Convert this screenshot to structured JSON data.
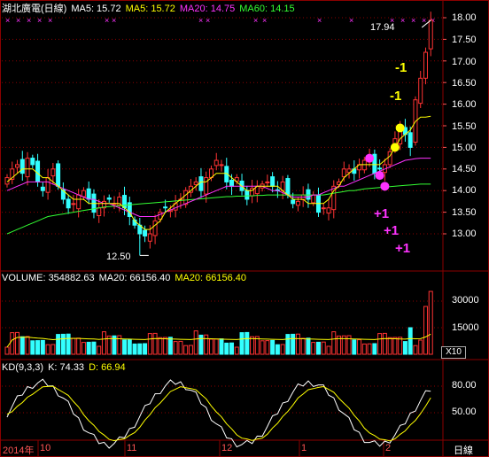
{
  "header": {
    "title": "湖北廣電(日線)",
    "ma5_a": "MA5: 15.72",
    "ma5_b": "MA5: 15.72",
    "ma20": "MA20: 14.75",
    "ma60": "MA60: 14.15"
  },
  "price_axis": [
    "18.00",
    "17.50",
    "17.00",
    "16.50",
    "16.00",
    "15.50",
    "15.00",
    "14.50",
    "14.00",
    "13.50",
    "13.00"
  ],
  "labels": {
    "high": "17.94",
    "low": "12.50"
  },
  "annotations": {
    "minus1": "-1",
    "minus2": "-1",
    "plus1": "+1",
    "plus2": "+1",
    "plus3": "+1"
  },
  "volume": {
    "header": "VOLUME: 354882.63",
    "ma20_a": "MA20: 66156.40",
    "ma20_b": "MA20: 66156.40",
    "axis": [
      "30000",
      "15000"
    ],
    "unit": "X10"
  },
  "kd": {
    "header": "KD(9,3,3)",
    "k": "K: 74.33",
    "d": "D: 66.94",
    "axis": [
      "80.00",
      "50.00"
    ]
  },
  "time_axis": {
    "months": [
      "2014年",
      "10",
      "11",
      "12",
      "1",
      "2"
    ],
    "period": "日線"
  },
  "colors": {
    "up": "#ff3333",
    "down": "#33ffff",
    "ma5": "#ffff00",
    "ma20": "#ff33ff",
    "ma60": "#33ff33",
    "grid": "#8b0000"
  },
  "chart_data": {
    "type": "candlestick",
    "close": [
      14.3,
      14.5,
      14.6,
      14.4,
      14.75,
      14.6,
      14.2,
      14.0,
      14.3,
      14.5,
      14.1,
      13.8,
      13.6,
      13.7,
      13.9,
      14.0,
      13.8,
      13.5,
      13.6,
      13.75,
      13.8,
      13.7,
      13.85,
      13.6,
      13.4,
      13.2,
      13.0,
      12.95,
      13.0,
      13.3,
      13.5,
      13.6,
      13.55,
      13.7,
      13.8,
      14.0,
      14.1,
      14.2,
      14.0,
      14.3,
      14.5,
      14.7,
      14.6,
      14.2,
      14.1,
      14.3,
      14.0,
      13.8,
      14.05,
      14.1,
      14.15,
      14.2,
      14.1,
      14.0,
      14.2,
      13.9,
      13.7,
      13.75,
      13.9,
      13.8,
      13.9,
      13.5,
      13.6,
      13.6,
      14.1,
      14.2,
      14.5,
      14.5,
      14.4,
      14.6,
      14.7,
      14.8,
      14.4,
      14.5,
      14.6,
      14.9,
      15.2,
      15.5,
      15.3,
      15.0,
      16.1,
      16.6,
      17.2,
      17.94
    ],
    "ma5": [
      14.2,
      14.3,
      14.4,
      14.5,
      14.5,
      14.5,
      14.4,
      14.3,
      14.3,
      14.2,
      14.1,
      14.0,
      13.9,
      13.8,
      13.8,
      13.8,
      13.7,
      13.7,
      13.7,
      13.7,
      13.7,
      13.7,
      13.7,
      13.6,
      13.5,
      13.3,
      13.2,
      13.1,
      13.1,
      13.2,
      13.3,
      13.5,
      13.6,
      13.7,
      13.8,
      13.9,
      14.0,
      14.1,
      14.2,
      14.2,
      14.3,
      14.4,
      14.4,
      14.4,
      14.3,
      14.2,
      14.1,
      14.0,
      14.0,
      14.1,
      14.1,
      14.1,
      14.1,
      14.1,
      14.0,
      13.9,
      13.8,
      13.8,
      13.8,
      13.7,
      13.7,
      13.7,
      13.7,
      13.8,
      14.0,
      14.1,
      14.3,
      14.4,
      14.5,
      14.6,
      14.6,
      14.6,
      14.6,
      14.6,
      14.7,
      14.8,
      15.0,
      15.2,
      15.3,
      15.4,
      15.6,
      15.7,
      15.7,
      15.72
    ],
    "ma20": [
      14.0,
      14.05,
      14.1,
      14.15,
      14.2,
      14.2,
      14.2,
      14.2,
      14.2,
      14.15,
      14.1,
      14.05,
      14.0,
      13.95,
      13.9,
      13.85,
      13.8,
      13.8,
      13.75,
      13.7,
      13.7,
      13.65,
      13.6,
      13.55,
      13.5,
      13.45,
      13.4,
      13.4,
      13.4,
      13.4,
      13.45,
      13.5,
      13.55,
      13.6,
      13.65,
      13.7,
      13.75,
      13.8,
      13.85,
      13.9,
      13.95,
      14.0,
      14.05,
      14.1,
      14.1,
      14.1,
      14.1,
      14.1,
      14.1,
      14.1,
      14.1,
      14.05,
      14.0,
      14.0,
      13.95,
      13.9,
      13.85,
      13.85,
      13.85,
      13.85,
      13.9,
      13.9,
      13.95,
      14.0,
      14.05,
      14.1,
      14.1,
      14.15,
      14.2,
      14.25,
      14.3,
      14.35,
      14.4,
      14.45,
      14.5,
      14.55,
      14.6,
      14.65,
      14.7,
      14.72,
      14.74,
      14.75,
      14.75,
      14.75
    ],
    "ma60": [
      13.0,
      13.05,
      13.1,
      13.15,
      13.2,
      13.25,
      13.3,
      13.35,
      13.4,
      13.42,
      13.44,
      13.46,
      13.48,
      13.5,
      13.52,
      13.54,
      13.56,
      13.58,
      13.6,
      13.62,
      13.63,
      13.64,
      13.65,
      13.66,
      13.67,
      13.68,
      13.69,
      13.7,
      13.71,
      13.72,
      13.73,
      13.74,
      13.75,
      13.76,
      13.77,
      13.78,
      13.79,
      13.8,
      13.81,
      13.82,
      13.83,
      13.84,
      13.85,
      13.86,
      13.86,
      13.87,
      13.87,
      13.88,
      13.88,
      13.89,
      13.89,
      13.9,
      13.9,
      13.9,
      13.9,
      13.9,
      13.9,
      13.9,
      13.9,
      13.9,
      13.9,
      13.9,
      13.9,
      13.92,
      13.94,
      13.96,
      13.98,
      14.0,
      14.0,
      14.02,
      14.04,
      14.05,
      14.06,
      14.07,
      14.08,
      14.09,
      14.1,
      14.11,
      14.12,
      14.13,
      14.14,
      14.15,
      14.15,
      14.15
    ],
    "ylim": [
      12.6,
      18.2
    ]
  }
}
